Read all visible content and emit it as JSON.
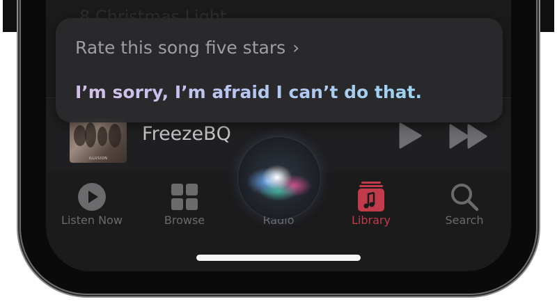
{
  "background_list": {
    "partial_row_text": "8  Christmas Light"
  },
  "siri": {
    "query_text": "Rate this song five stars",
    "query_chevron": "›",
    "response_text": "I’m sorry, I’m afraid I can’t do that."
  },
  "now_playing": {
    "track_title": "FreezeBQ",
    "album_caption": "ILLUSION",
    "play_icon": "play-icon",
    "forward_icon": "fast-forward-icon"
  },
  "tabbar": {
    "tabs": [
      {
        "label": "Listen Now",
        "icon": "listen-now-icon",
        "active": false
      },
      {
        "label": "Browse",
        "icon": "browse-grid-icon",
        "active": false
      },
      {
        "label": "Radio",
        "icon": "radio-icon",
        "active": false
      },
      {
        "label": "Library",
        "icon": "library-icon",
        "active": true
      },
      {
        "label": "Search",
        "icon": "search-icon",
        "active": false
      }
    ]
  },
  "colors": {
    "accent_active": "#c23b4b",
    "tab_inactive": "#6b6b6e",
    "siri_gradient_start": "#d7bfe6",
    "siri_gradient_end": "#9cd3f0"
  }
}
